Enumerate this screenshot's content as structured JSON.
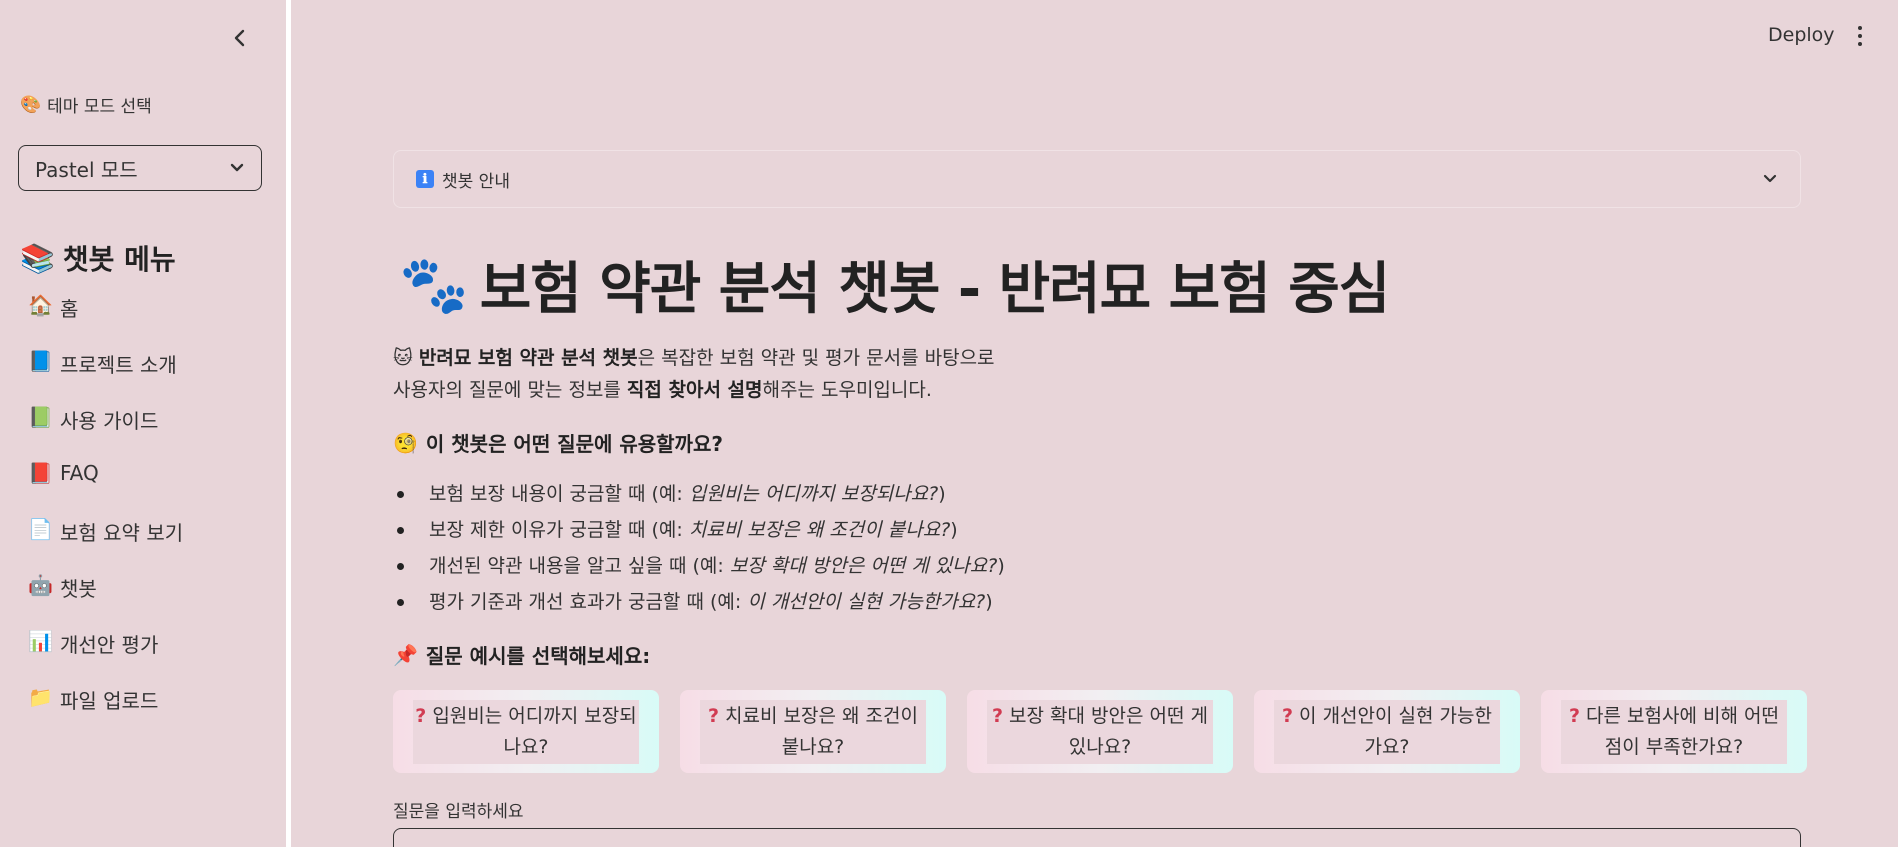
{
  "sidebar": {
    "collapse_icon": "chevron-left-icon",
    "theme_label_emoji": "🎨",
    "theme_label": "테마 모드 선택",
    "theme_selected": "Pastel 모드",
    "menu_title_emoji": "📚",
    "menu_title": "챗봇 메뉴",
    "items": [
      {
        "emoji": "🏠",
        "label": "홈"
      },
      {
        "emoji": "📘",
        "label": "프로젝트 소개"
      },
      {
        "emoji": "📗",
        "label": "사용 가이드"
      },
      {
        "emoji": "📕",
        "label": "FAQ"
      },
      {
        "emoji": "📄",
        "label": "보험 요약 보기"
      },
      {
        "emoji": "🤖",
        "label": "챗봇"
      },
      {
        "emoji": "📊",
        "label": "개선안 평가"
      },
      {
        "emoji": "📁",
        "label": "파일 업로드"
      }
    ]
  },
  "header": {
    "deploy_label": "Deploy",
    "menu_icon": "kebab-menu-icon"
  },
  "main": {
    "expander_icon": "ℹ",
    "expander_label": "챗봇 안내",
    "title_emoji": "🐾",
    "title": "보험 약관 분석 챗봇 - 반려묘 보험 중심",
    "intro": {
      "emoji": "🐱",
      "bold1": "반려묘 보험 약관 분석 챗봇",
      "text1": "은 복잡한 보험 약관 및 평가 문서를 바탕으로",
      "text2": "사용자의 질문에 맞는 정보를 ",
      "bold2": "직접 찾아서 설명",
      "text3": "해주는 도우미입니다."
    },
    "usage_heading_emoji": "🧐",
    "usage_heading": "이 챗봇은 어떤 질문에 유용할까요?",
    "bullets": [
      {
        "text": "보험 보장 내용이 궁금할 때 (예: ",
        "example": "입원비는 어디까지 보장되나요?",
        "close": ")"
      },
      {
        "text": "보장 제한 이유가 궁금할 때 (예: ",
        "example": "치료비 보장은 왜 조건이 붙나요?",
        "close": ")"
      },
      {
        "text": "개선된 약관 내용을 알고 싶을 때 (예: ",
        "example": "보장 확대 방안은 어떤 게 있나요?",
        "close": ")"
      },
      {
        "text": "평가 기준과 개선 효과가 궁금할 때 (예: ",
        "example": "이 개선안이 실현 가능한가요?",
        "close": ")"
      }
    ],
    "examples_heading_emoji": "📌",
    "examples_heading": "질문 예시를 선택해보세요:",
    "question_mark": "?",
    "questions": [
      "입원비는 어디까지 보장되나요?",
      "치료비 보장은 왜 조건이 붙나요?",
      "보장 확대 방안은 어떤 게 있나요?",
      "이 개선안이 실현 가능한가요?",
      "다른 보험사에 비해 어떤 점이 부족한가요?"
    ],
    "input_label": "질문을 입력하세요",
    "input_placeholder": "",
    "input_value": ""
  }
}
